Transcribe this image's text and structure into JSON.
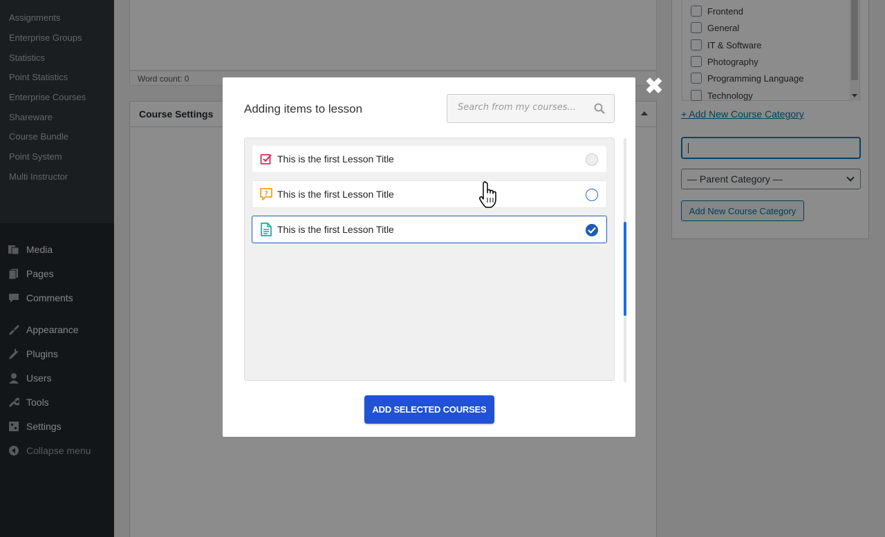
{
  "sidebar": {
    "top_items": [
      "Assignments",
      "Enterprise Groups",
      "Statistics",
      "Point Statistics",
      "Enterprise Courses",
      "Shareware",
      "Course Bundle",
      "Point System",
      "Multi Instructor"
    ],
    "main_items": [
      {
        "label": "Media",
        "icon": "media-icon"
      },
      {
        "label": "Pages",
        "icon": "pages-icon"
      },
      {
        "label": "Comments",
        "icon": "comments-icon"
      },
      {
        "label": "Appearance",
        "icon": "appearance-icon"
      },
      {
        "label": "Plugins",
        "icon": "plugins-icon"
      },
      {
        "label": "Users",
        "icon": "users-icon"
      },
      {
        "label": "Tools",
        "icon": "tools-icon"
      },
      {
        "label": "Settings",
        "icon": "settings-icon"
      },
      {
        "label": "Collapse menu",
        "icon": "collapse-icon"
      }
    ]
  },
  "editor": {
    "word_count": "Word count: 0"
  },
  "course_settings": {
    "title": "Course Settings"
  },
  "categories": {
    "items": [
      "Frontend",
      "General",
      "IT & Software",
      "Photography",
      "Programming Language",
      "Technology"
    ],
    "add_new_link": "+ Add New Course Category",
    "parent_select": "— Parent Category —",
    "add_button": "Add New Course Category"
  },
  "modal": {
    "title": "Adding items to lesson",
    "search_placeholder": "Search from my courses...",
    "lessons": [
      {
        "title": "This is the first Lesson Title",
        "type": "assignment",
        "state": "disabled",
        "icon_color": "#e0245e"
      },
      {
        "title": "This is the first Lesson Title",
        "type": "quiz",
        "state": "unselected",
        "icon_color": "#f0a020"
      },
      {
        "title": "This is the first Lesson Title",
        "type": "document",
        "state": "selected",
        "icon_color": "#16a99a"
      }
    ],
    "add_button": "ADD SELECTED COURSES",
    "close_glyph": "✖"
  },
  "colors": {
    "accent": "#2151d4",
    "selected_border": "#1e5bb8",
    "link": "#0073aa"
  }
}
